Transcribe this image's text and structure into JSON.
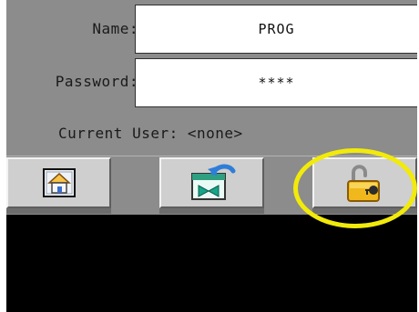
{
  "login": {
    "name_label": "Name:",
    "name_value": "PROG",
    "password_label": "Password:",
    "password_value": "****",
    "current_user_text": "Current User: <none>"
  },
  "toolbar": {
    "buttons": [
      {
        "icon": "home-icon"
      },
      {
        "icon": "screen-return-icon"
      },
      {
        "icon": "unlock-padlock-icon"
      }
    ]
  },
  "colors": {
    "panel": "#8c8c8c",
    "field": "#ffffff",
    "button": "#cfcfcf",
    "display_off": "#000000",
    "highlight_ring": "#f2ea0a"
  }
}
